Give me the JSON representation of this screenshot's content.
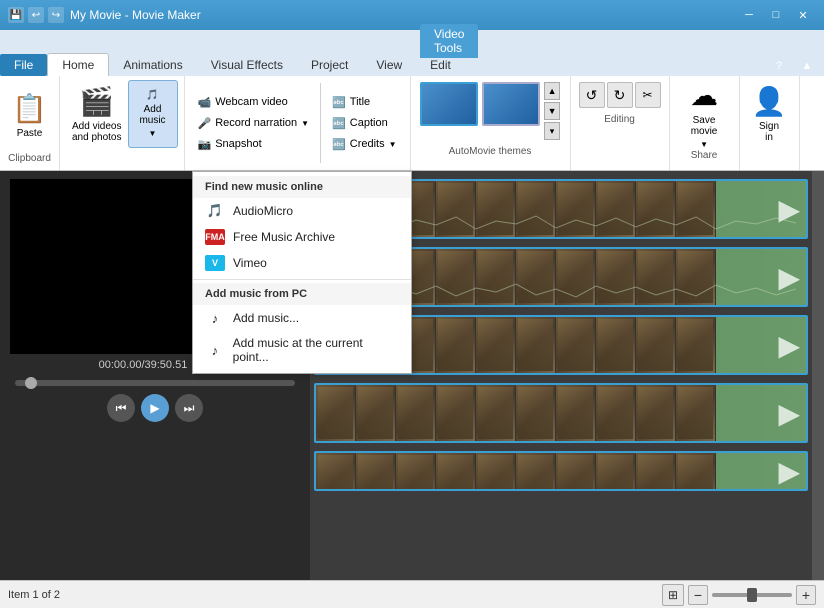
{
  "titlebar": {
    "title": "My Movie - Movie Maker",
    "video_tools": "Video Tools",
    "min": "─",
    "max": "□",
    "close": "✕"
  },
  "tabs": {
    "file": "File",
    "home": "Home",
    "animations": "Animations",
    "visual_effects": "Visual Effects",
    "project": "Project",
    "view": "View",
    "edit": "Edit"
  },
  "ribbon": {
    "clipboard": {
      "label": "Clipboard",
      "paste": "Paste"
    },
    "add_group": {
      "add_videos_label": "Add videos\nand photos",
      "add_music_label": "Add\nmusic"
    },
    "home_items": {
      "webcam_video": "Webcam video",
      "record_narration": "Record narration",
      "snapshot": "Snapshot",
      "title": "Title",
      "caption": "Caption",
      "credits": "Credits"
    },
    "autocomplete": {
      "label": "AutoMovie themes"
    },
    "editing": {
      "label": "Editing"
    },
    "save": {
      "label": "Save\nmovie"
    },
    "share": {
      "label": "Share",
      "sign_in": "Sign\nin"
    }
  },
  "dropdown": {
    "section1": "Find new music online",
    "audiomicro": "AudioMicro",
    "free_music_archive": "Free Music Archive",
    "vimeo": "Vimeo",
    "section2": "Add music from PC",
    "add_music": "Add music...",
    "add_music_current": "Add music at the current point..."
  },
  "preview": {
    "time": "00:00.00/39:50.51"
  },
  "status": {
    "item": "Item 1 of 2"
  }
}
